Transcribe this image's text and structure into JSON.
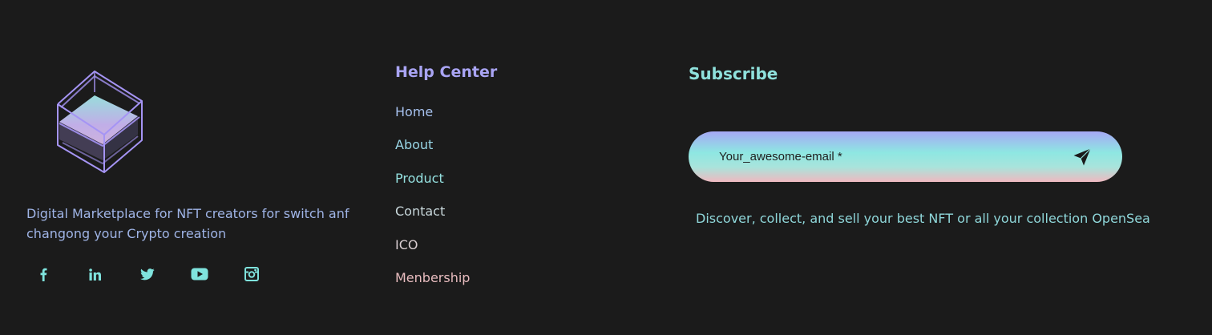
{
  "brand": {
    "logo_icon": "glass-cube-logo",
    "tagline": "Digital Marketplace for NFT creators for switch anf changong your Crypto creation"
  },
  "socials": [
    {
      "name": "facebook",
      "icon": "facebook-icon"
    },
    {
      "name": "linkedin",
      "icon": "linkedin-icon"
    },
    {
      "name": "twitter",
      "icon": "twitter-icon"
    },
    {
      "name": "youtube",
      "icon": "youtube-icon"
    },
    {
      "name": "instagram",
      "icon": "instagram-icon"
    }
  ],
  "help_center": {
    "title": "Help Center",
    "links": [
      "Home",
      "About",
      "Product",
      "Contact",
      "ICO",
      "Menbership"
    ]
  },
  "subscribe": {
    "title": "Subscribe",
    "email_placeholder": "Your_awesome-email *",
    "email_value": "",
    "send_icon": "send-icon",
    "description": "Discover, collect, and sell your best NFT or all your collection OpenSea"
  },
  "colors": {
    "background": "#1b1b1b",
    "accent_purple": "#a9a4f3",
    "accent_teal": "#8fe1dc",
    "accent_pink": "#efb9c0",
    "social_icon": "#7fe3dd"
  }
}
